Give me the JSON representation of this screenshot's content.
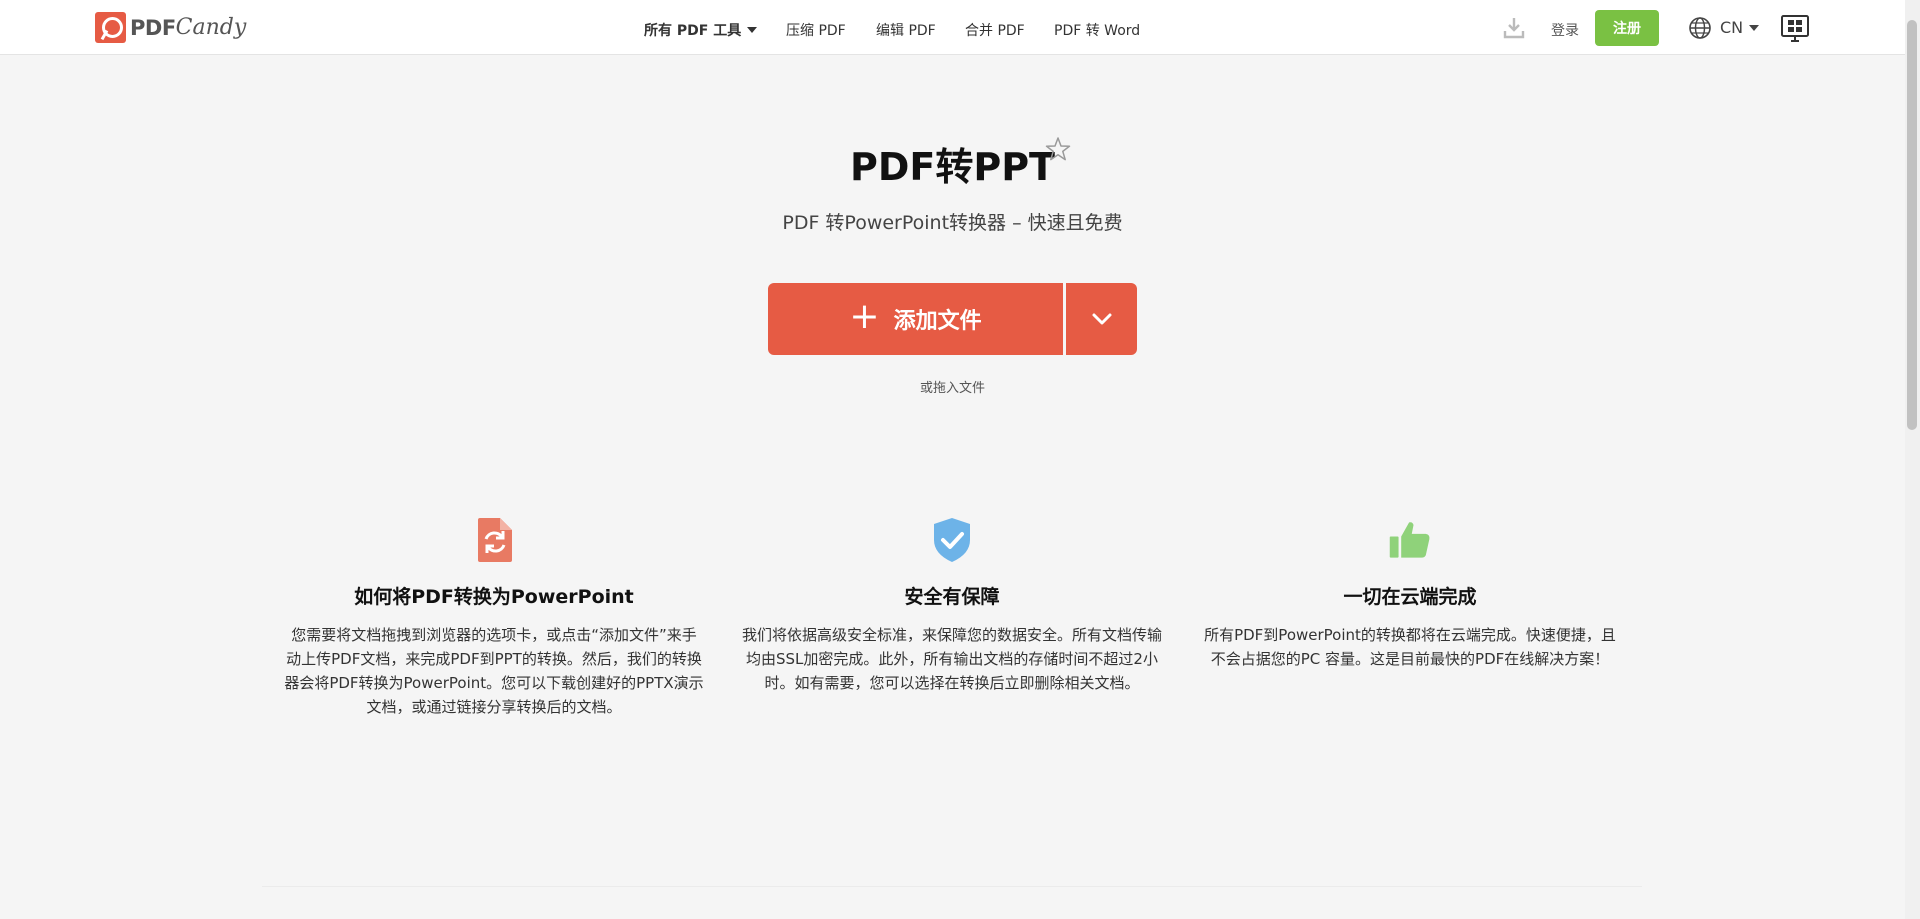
{
  "brand": {
    "pdf": "PDF",
    "candy": "Candy"
  },
  "nav": {
    "all_tools": "所有 PDF 工具",
    "compress": "压缩 PDF",
    "edit": "编辑 PDF",
    "merge": "合并 PDF",
    "pdf_to_word": "PDF 转 Word"
  },
  "header": {
    "login": "登录",
    "signup": "注册",
    "lang": "CN"
  },
  "hero": {
    "title": "PDF转PPT",
    "subtitle": "PDF 转PowerPoint转换器 – 快速且免费",
    "add_file": "添加文件",
    "or_drag": "或拖入文件"
  },
  "features": [
    {
      "title": "如何将PDF转换为PowerPoint",
      "text": "您需要将文档拖拽到浏览器的选项卡，或点击“添加文件”来手动上传PDF文档，来完成PDF到PPT的转换。然后，我们的转换器会将PDF转换为PowerPoint。您可以下载创建好的PPTX演示文档，或通过链接分享转换后的文档。"
    },
    {
      "title": "安全有保障",
      "text": "我们将依据高级安全标准，来保障您的数据安全。所有文档传输均由SSL加密完成。此外，所有输出文档的存储时间不超过2小时。如有需要，您可以选择在转换后立即删除相关文档。"
    },
    {
      "title": "一切在云端完成",
      "text": "所有PDF到PowerPoint的转换都将在云端完成。快速便捷，且不会占据您的PC 容量。这是目前最快的PDF在线解决方案！"
    }
  ],
  "colors": {
    "accent": "#e65b44",
    "signup": "#7ac143",
    "shield": "#6db3e8",
    "thumb": "#8fd27a"
  }
}
